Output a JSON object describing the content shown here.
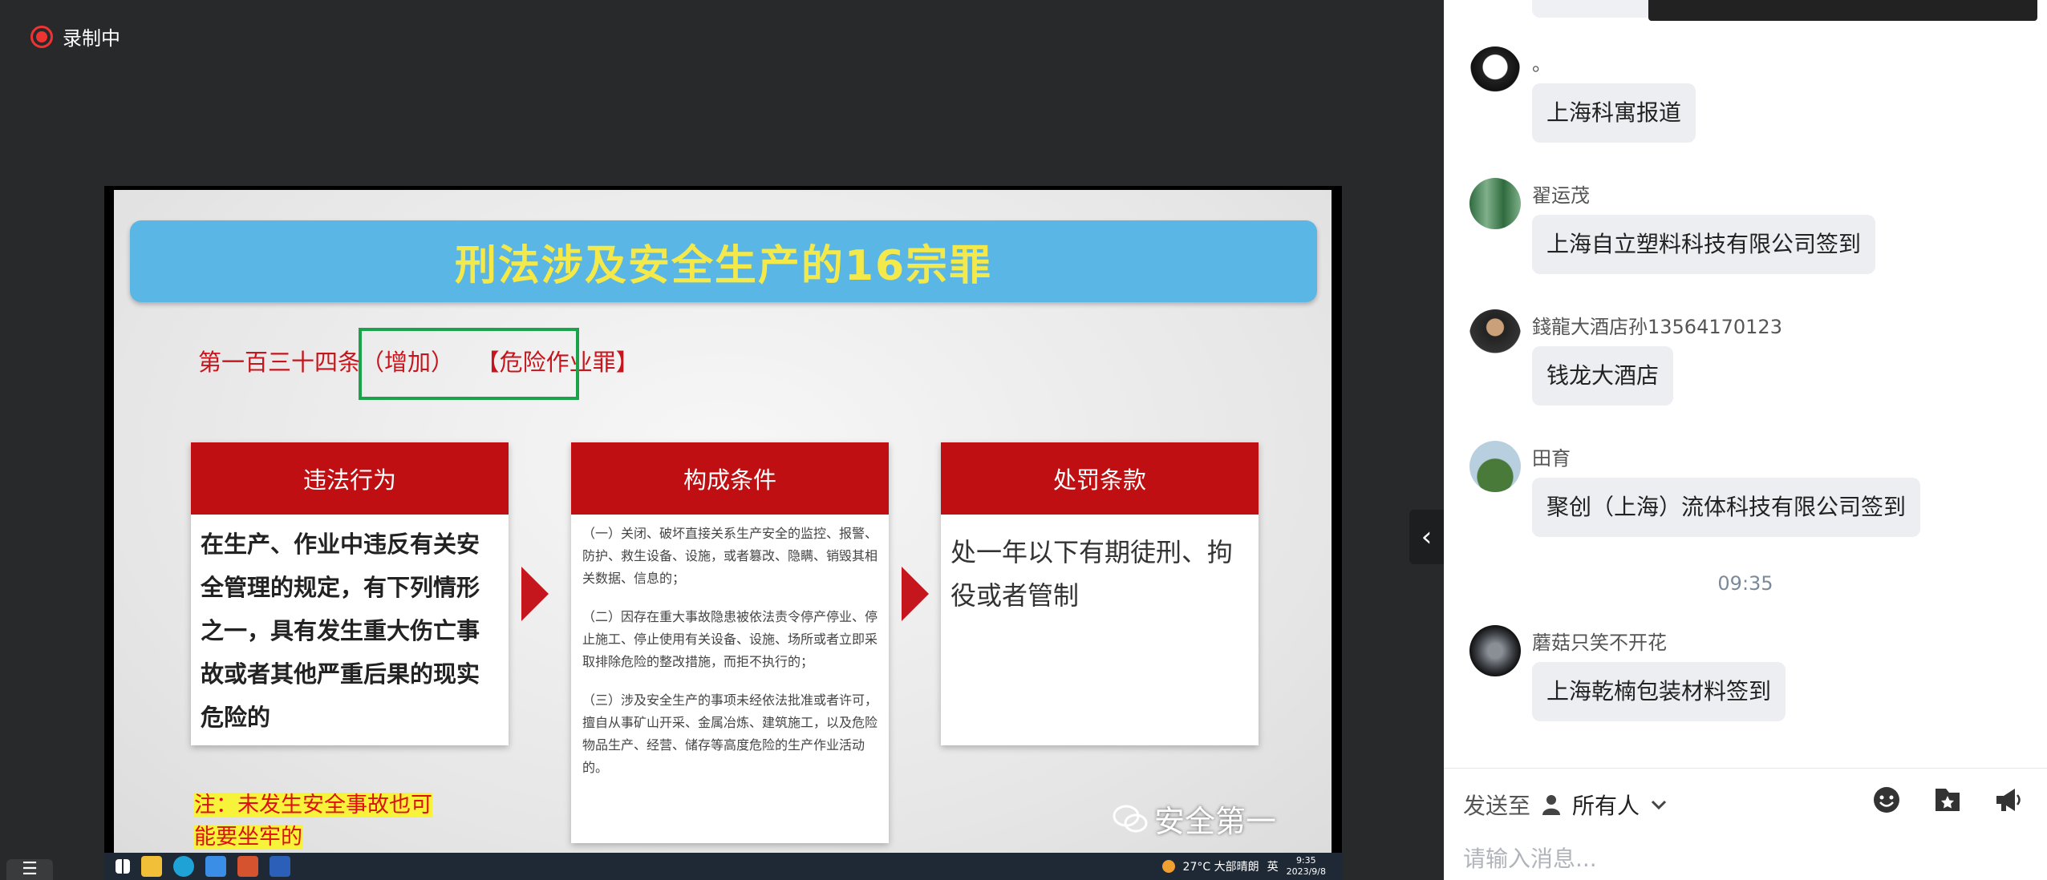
{
  "recording": {
    "label": "录制中"
  },
  "slide": {
    "title": "刑法涉及安全生产的16宗罪",
    "article": "第一百三十四条（增加）   【危险作业罪】",
    "card1": {
      "head": "违法行为",
      "body": "在生产、作业中违反有关安全管理的规定，有下列情形之一，具有发生重大伤亡事故或者其他严重后果的现实危险的"
    },
    "card2": {
      "head": "构成条件",
      "p1": "（一）关闭、破坏直接关系生产安全的监控、报警、防护、救生设备、设施，或者篡改、隐瞒、销毁其相关数据、信息的；",
      "p2": "（二）因存在重大事故隐患被依法责令停产停业、停止施工、停止使用有关设备、设施、场所或者立即采取排除危险的整改措施，而拒不执行的；",
      "p3": "（三）涉及安全生产的事项未经依法批准或者许可，擅自从事矿山开采、金属冶炼、建筑施工，以及危险物品生产、经营、储存等高度危险的生产作业活动的。"
    },
    "card3": {
      "head": "处罚条款",
      "body": "处一年以下有期徒刑、拘役或者管制"
    },
    "note_line1": "注：未发生安全事故也可",
    "note_line2": "能要坐牢的",
    "watermark": "安全第一"
  },
  "taskbar": {
    "weather": "27°C 大部晴朗",
    "lang": "英",
    "time": "9:35",
    "date": "2023/9/8"
  },
  "chat": {
    "messages": [
      {
        "name": "。",
        "text": "上海科寓报道"
      },
      {
        "name": "翟运茂",
        "text": "上海自立塑料科技有限公司签到"
      },
      {
        "name": "錢龍大酒店孙13564170123",
        "text": "钱龙大酒店"
      },
      {
        "name": "田育",
        "text": "聚创（上海）流体科技有限公司签到"
      },
      {
        "name": "蘑菇只笑不开花",
        "text": "上海乾楠包装材料签到"
      }
    ],
    "timestamp": "09:35",
    "send_to_label": "发送至",
    "recipient": "所有人",
    "input_placeholder": "请输入消息...",
    "icons": [
      "emoji-icon",
      "favorite-icon",
      "megaphone-icon",
      "chevron-left-icon",
      "person-icon"
    ]
  }
}
